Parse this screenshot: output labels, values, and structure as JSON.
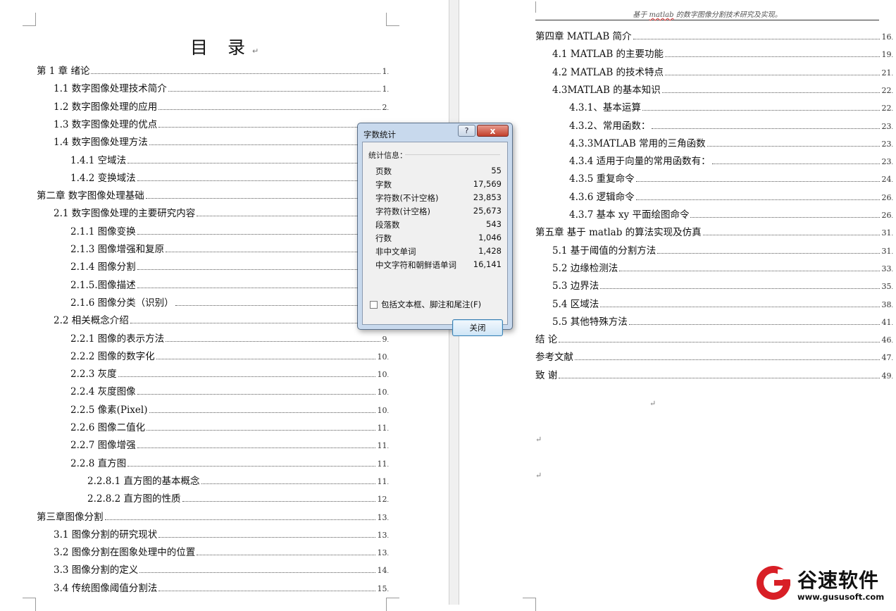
{
  "left_page": {
    "title": "目 录",
    "para_mark": "↵",
    "entries": [
      {
        "text": "第 1 章  绪论",
        "page": "1"
      },
      {
        "text": "1.1 数字图像处理技术简介",
        "page": "1"
      },
      {
        "text": "1.2 数字图像处理的应用",
        "page": "2"
      },
      {
        "text": "1.3 数字图像处理的优点",
        "page": ""
      },
      {
        "text": "1.4 数字图像处理方法",
        "page": ""
      },
      {
        "text": "1.4.1 空域法",
        "page": ""
      },
      {
        "text": "1.4.2 变换域法",
        "page": ""
      },
      {
        "text": "第二章  数字图像处理基础",
        "page": ""
      },
      {
        "text": "2.1  数字图像处理的主要研究内容",
        "page": ""
      },
      {
        "text": "2.1.1 图像变换",
        "page": ""
      },
      {
        "text": "2.1.3 图像增强和复原",
        "page": ""
      },
      {
        "text": "2.1.4 图像分割",
        "page": ""
      },
      {
        "text": "2.1.5.图像描述",
        "page": ""
      },
      {
        "text": "2.1.6 图像分类（识别）",
        "page": ""
      },
      {
        "text": "2.2 相关概念介绍",
        "page": ""
      },
      {
        "text": "2.2.1 图像的表示方法",
        "page": "9"
      },
      {
        "text": "2.2.2 图像的数字化",
        "page": "10"
      },
      {
        "text": "2.2.3 灰度",
        "page": "10"
      },
      {
        "text": "2.2.4 灰度图像",
        "page": "10"
      },
      {
        "text": "2.2.5 像素(Pixel)",
        "page": "10"
      },
      {
        "text": "2.2.6 图像二值化",
        "page": "11"
      },
      {
        "text": "2.2.7 图像增强",
        "page": "11"
      },
      {
        "text": "2.2.8 直方图",
        "page": "11"
      },
      {
        "text": "2.2.8.1 直方图的基本概念",
        "page": "11"
      },
      {
        "text": "2.2.8.2 直方图的性质",
        "page": "12"
      },
      {
        "text": "第三章图像分割",
        "page": "13"
      },
      {
        "text": "3.1  图像分割的研究现状",
        "page": "13"
      },
      {
        "text": "3.2 图像分割在图象处理中的位置",
        "page": "13"
      },
      {
        "text": "3.3  图像分割的定义",
        "page": "14"
      },
      {
        "text": "3.4 传统图像阈值分割法",
        "page": "15"
      }
    ]
  },
  "right_page": {
    "header_prefix": "基于 ",
    "header_word": "matlab",
    "header_suffix": " 的数字图像分割技术研究及实现。",
    "entries": [
      {
        "text": "第四章  MATLAB 简介",
        "page": "16"
      },
      {
        "text": "4.1  MATLAB 的主要功能",
        "page": "19"
      },
      {
        "text": "4.2  MATLAB 的技术特点",
        "page": "21"
      },
      {
        "text": "4.3MATLAB 的基本知识",
        "page": "22"
      },
      {
        "text": "4.3.1、基本运算",
        "page": "22"
      },
      {
        "text": "4.3.2、常用函数：",
        "page": "23"
      },
      {
        "text": "4.3.3MATLAB 常用的三角函数",
        "page": "23"
      },
      {
        "text": "4.3.4 适用于向量的常用函数有：",
        "page": "23"
      },
      {
        "text": "4.3.5 重复命令",
        "page": "24"
      },
      {
        "text": "4.3.6 逻辑命令",
        "page": "26"
      },
      {
        "text": "4.3.7 基本 xy 平面绘图命令",
        "page": "26"
      },
      {
        "text": "第五章  基于 matlab 的算法实现及仿真",
        "page": "31"
      },
      {
        "text": "5.1 基于阈值的分割方法",
        "page": "31"
      },
      {
        "text": "5.2 边缘检测法",
        "page": "33"
      },
      {
        "text": "5.3 边界法",
        "page": "35"
      },
      {
        "text": "5.4 区域法",
        "page": "38"
      },
      {
        "text": "5.5 其他特殊方法",
        "page": "41"
      },
      {
        "text": "结    论",
        "page": "46"
      },
      {
        "text": "参考文献",
        "page": "47"
      },
      {
        "text": "致    谢",
        "page": "49"
      }
    ]
  },
  "dialog": {
    "title": "字数统计",
    "help_label": "?",
    "close_x": "x",
    "group_label": "统计信息：",
    "stats": [
      {
        "label": "页数",
        "value": "55"
      },
      {
        "label": "字数",
        "value": "17,569"
      },
      {
        "label": "字符数(不计空格)",
        "value": "23,853"
      },
      {
        "label": "字符数(计空格)",
        "value": "25,673"
      },
      {
        "label": "段落数",
        "value": "543"
      },
      {
        "label": "行数",
        "value": "1,046"
      },
      {
        "label": "非中文单词",
        "value": "1,428"
      },
      {
        "label": "中文字符和朝鲜语单词",
        "value": "16,141"
      }
    ],
    "checkbox_label": "包括文本框、脚注和尾注(F)",
    "checkbox_checked": false,
    "close_button": "关闭"
  },
  "watermark": {
    "name": "谷速软件",
    "url": "www.gususoft.com",
    "brand_color": "#d81f26"
  }
}
